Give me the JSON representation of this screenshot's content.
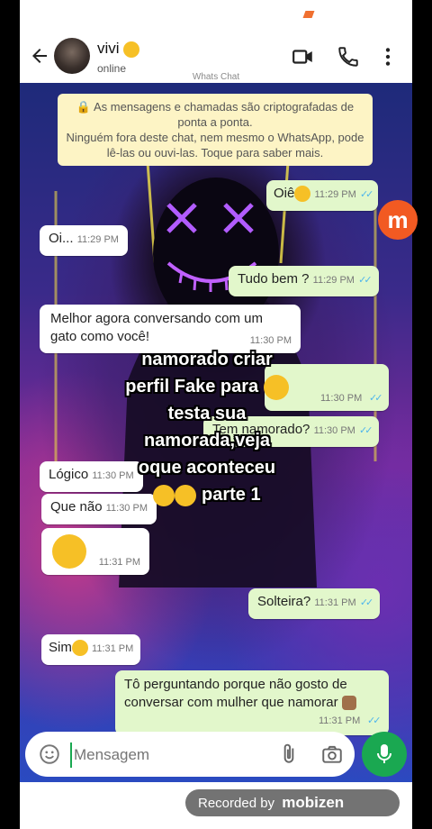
{
  "header": {
    "contact_name": "vivi",
    "contact_status": "online"
  },
  "watermark_top": "Whats Chat",
  "notice": {
    "line1": "Ninguém fora deste chat, nem mesmo o WhatsApp, pode lê-las ou ouvi-las. Toque para saber mais.",
    "headline": "As mensagens e chamadas são criptografadas de ponta a ponta."
  },
  "messages": [
    {
      "side": "out",
      "text": "Oiê",
      "time": "11:29 PM"
    },
    {
      "side": "in",
      "text": "Oi...",
      "time": "11:29 PM"
    },
    {
      "side": "out",
      "text": "Tudo bem ?",
      "time": "11:29 PM"
    },
    {
      "side": "in",
      "text": "Melhor agora conversando com um gato como você!",
      "time": "11:30 PM"
    },
    {
      "side": "out",
      "text": "",
      "time": "11:30 PM"
    },
    {
      "side": "out",
      "text": "Tem namorado?",
      "time": "11:30 PM"
    },
    {
      "side": "in",
      "text": "Lógico",
      "time": "11:30 PM"
    },
    {
      "side": "in",
      "text": "Que não",
      "time": "11:30 PM"
    },
    {
      "side": "in",
      "text": "",
      "time": "11:31 PM"
    },
    {
      "side": "out",
      "text": "Solteira?",
      "time": "11:31 PM"
    },
    {
      "side": "in",
      "text": "Sim",
      "time": "11:31 PM"
    },
    {
      "side": "out",
      "text": "Tô perguntando porque não gosto de conversar com mulher que namorar",
      "time": "11:31 PM"
    }
  ],
  "overlay_text": {
    "line1": "namorado criar",
    "line2": "perfil Fake para",
    "line3": "testa sua",
    "line4": "namorada,veja",
    "line5": "oque aconteceu",
    "line6": "parte 1"
  },
  "input": {
    "placeholder": "Mensagem"
  },
  "recorder": {
    "label": "Recorded by",
    "brand": "mobizen",
    "logo_letter": "m"
  },
  "colors": {
    "outgoing_bubble": "#e2f7cb",
    "incoming_bubble": "#ffffff",
    "mic_button": "#1aa851",
    "read_ticks": "#4fb6ec"
  }
}
